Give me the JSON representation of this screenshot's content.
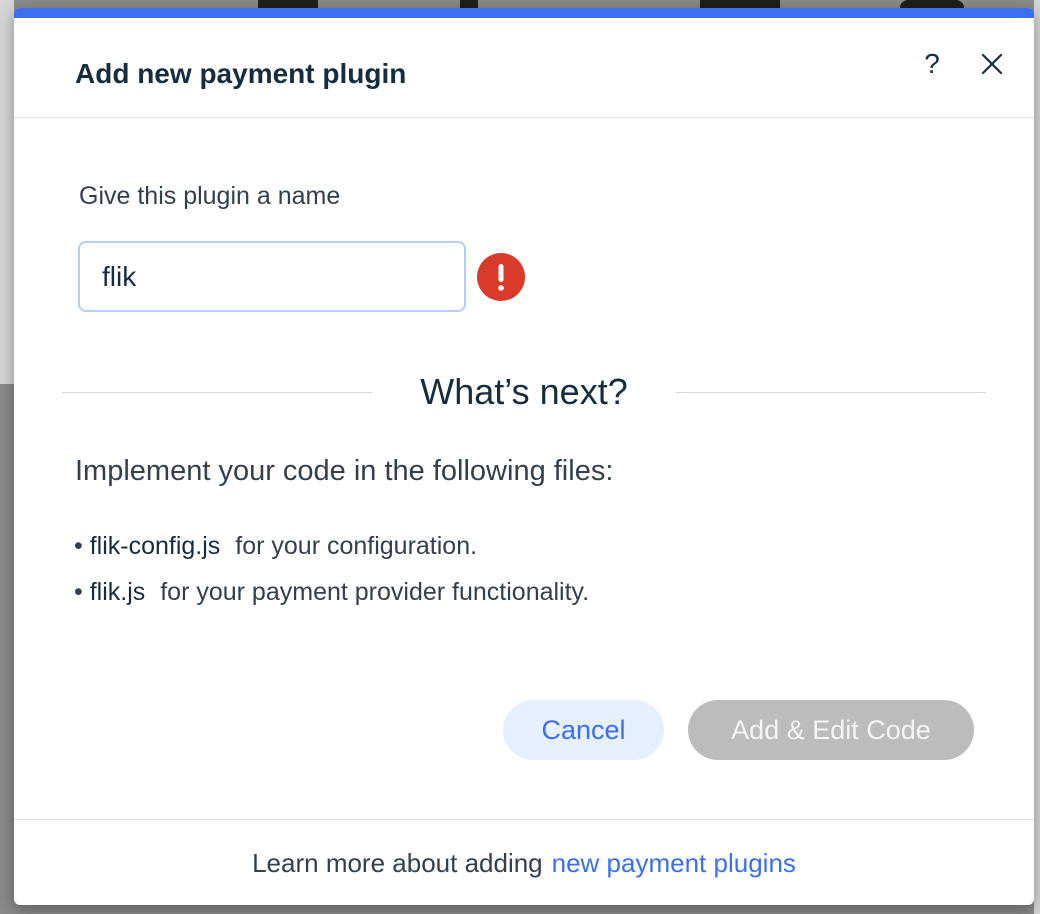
{
  "dialog": {
    "title": "Add new payment plugin",
    "help_label": "?",
    "accent_color": "#3b6ff0"
  },
  "form": {
    "name_label": "Give this plugin a name",
    "name_value": "flik",
    "error_color": "#d93a2c"
  },
  "next_section": {
    "heading": "What’s next?",
    "instructions": "Implement your code in the following files:",
    "files": [
      {
        "bullet": "•",
        "name": "flik-config.js",
        "desc": "for your configuration."
      },
      {
        "bullet": "•",
        "name": "flik.js",
        "desc": "for your payment provider functionality."
      }
    ]
  },
  "buttons": {
    "cancel_label": "Cancel",
    "add_label": "Add & Edit Code"
  },
  "footer": {
    "text": "Learn more about adding",
    "link_text": "new payment plugins"
  },
  "icons": {
    "help": "help-icon",
    "close": "close-icon",
    "error": "error-icon"
  }
}
